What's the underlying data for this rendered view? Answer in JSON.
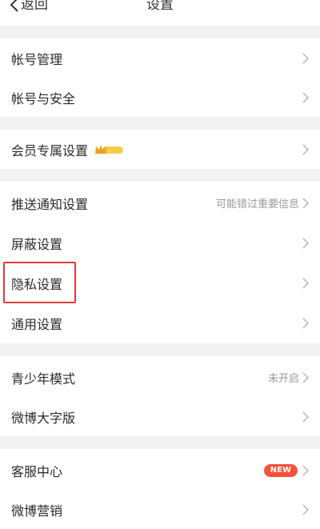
{
  "header": {
    "back_label": "返回",
    "title": "设置"
  },
  "sections": [
    {
      "items": [
        {
          "label": "帐号管理"
        },
        {
          "label": "帐号与安全"
        }
      ]
    },
    {
      "items": [
        {
          "label": "会员专属设置",
          "badge": "vip-crown-badge"
        }
      ]
    },
    {
      "items": [
        {
          "label": "推送通知设置",
          "value": "可能错过重要信息"
        },
        {
          "label": "屏蔽设置"
        },
        {
          "label": "隐私设置",
          "highlighted": true
        },
        {
          "label": "通用设置"
        }
      ]
    },
    {
      "items": [
        {
          "label": "青少年模式",
          "value": "未开启"
        },
        {
          "label": "微博大字版"
        }
      ]
    },
    {
      "items": [
        {
          "label": "客服中心",
          "badge_text": "NEW"
        },
        {
          "label": "微博营销"
        }
      ]
    }
  ],
  "colors": {
    "background": "#ffffff",
    "section_gap": "#f2f2f2",
    "highlight_border": "#e23b3b",
    "new_badge": "#f5503a",
    "vip_badge": "#f7c948"
  }
}
